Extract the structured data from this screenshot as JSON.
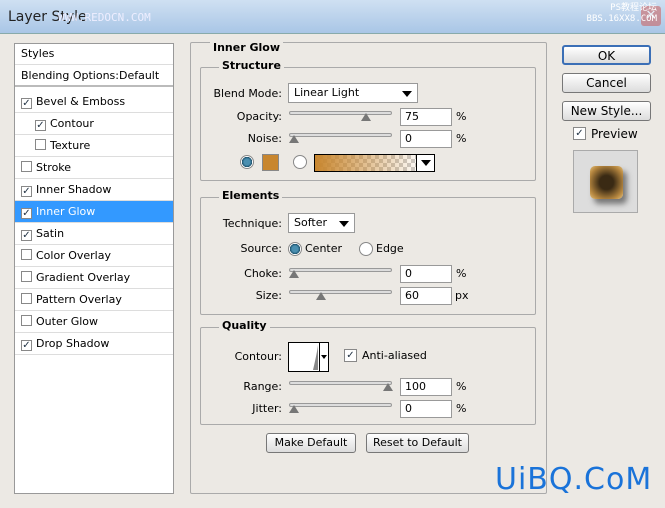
{
  "window": {
    "title": "Layer Style",
    "watermark_top": "WWW.REDOCN.COM",
    "watermark_right_1": "PS教程论坛",
    "watermark_right_2": "BBS.16XX8.COM",
    "watermark_bottom": "UiBQ.CoM",
    "close": "✕"
  },
  "sidebar": {
    "items": [
      {
        "label": "Styles",
        "checkbox": false
      },
      {
        "label": "Blending Options:Default",
        "checkbox": false
      },
      {
        "label": "Bevel & Emboss",
        "checked": true
      },
      {
        "label": "Contour",
        "checked": true
      },
      {
        "label": "Texture",
        "checked": false
      },
      {
        "label": "Stroke",
        "checked": false
      },
      {
        "label": "Inner Shadow",
        "checked": true
      },
      {
        "label": "Inner Glow",
        "checked": true,
        "selected": true
      },
      {
        "label": "Satin",
        "checked": true
      },
      {
        "label": "Color Overlay",
        "checked": false
      },
      {
        "label": "Gradient Overlay",
        "checked": false
      },
      {
        "label": "Pattern Overlay",
        "checked": false
      },
      {
        "label": "Outer Glow",
        "checked": false
      },
      {
        "label": "Drop Shadow",
        "checked": true
      }
    ]
  },
  "panel": {
    "title": "Inner Glow",
    "structure": {
      "title": "Structure",
      "blend_mode_label": "Blend Mode:",
      "blend_mode": "Linear Light",
      "opacity_label": "Opacity:",
      "opacity": "75",
      "noise_label": "Noise:",
      "noise": "0",
      "pct": "%",
      "color": "#c8862e",
      "color_mode": "solid"
    },
    "elements": {
      "title": "Elements",
      "technique_label": "Technique:",
      "technique": "Softer",
      "source_label": "Source:",
      "source_center": "Center",
      "source_edge": "Edge",
      "source_selected": "Center",
      "choke_label": "Choke:",
      "choke": "0",
      "size_label": "Size:",
      "size": "60",
      "px": "px",
      "pct": "%"
    },
    "quality": {
      "title": "Quality",
      "contour_label": "Contour:",
      "anti_aliased": "Anti-aliased",
      "anti_aliased_checked": true,
      "range_label": "Range:",
      "range": "100",
      "jitter_label": "Jitter:",
      "jitter": "0",
      "pct": "%"
    },
    "make_default": "Make Default",
    "reset_default": "Reset to Default"
  },
  "actions": {
    "ok": "OK",
    "cancel": "Cancel",
    "new_style": "New Style...",
    "preview": "Preview",
    "preview_checked": true
  },
  "check": "✓"
}
